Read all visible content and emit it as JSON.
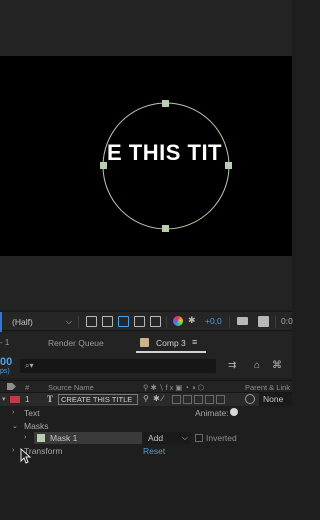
{
  "composition": {
    "canvas_text": "E THIS TIT"
  },
  "viewer_toolbar": {
    "resolution": "(Half)",
    "exposure": "+0,0",
    "time_partial": "0:0"
  },
  "panel_tabs": {
    "edge_label": "- 1",
    "render_queue": "Render Queue",
    "comp": "Comp 3"
  },
  "timeline": {
    "timecode": "00",
    "fps": "ps)",
    "search_placeholder": "",
    "columns": {
      "num": "#",
      "source_name": "Source Name",
      "parent_link": "Parent & Link"
    },
    "layer": {
      "number": "1",
      "type_icon": "T",
      "name": "CREATE THIS TITLE",
      "parent": "None",
      "label_color": "#c23a45"
    },
    "properties": {
      "text": "Text",
      "animate": "Animate:",
      "masks": "Masks",
      "mask_name": "Mask 1",
      "mask_mode": "Add",
      "inverted": "Inverted",
      "transform": "Transform",
      "reset": "Reset"
    }
  },
  "colors": {
    "accent_blue": "#4a9fe6",
    "mask_path": "#b9cdb0"
  }
}
